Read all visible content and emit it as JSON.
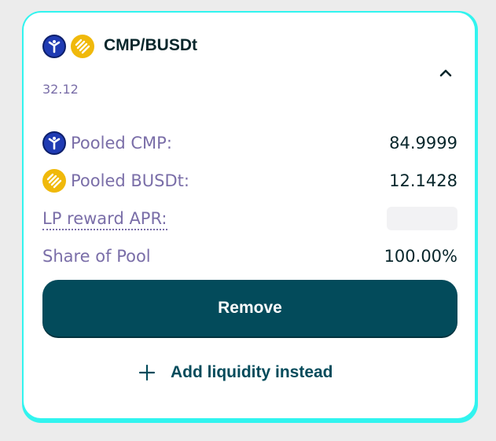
{
  "pair": {
    "title": "CMP/BUSDt",
    "balance": "32.12",
    "token0_icon": "cmp-token-icon",
    "token1_icon": "busdt-token-icon",
    "toggle_icon": "chevron-up-icon"
  },
  "details": {
    "pooled_token0_label": "Pooled CMP:",
    "pooled_token0_value": "84.9999",
    "pooled_token1_label": "Pooled BUSDt:",
    "pooled_token1_value": "12.1428",
    "apr_label": "LP reward APR:",
    "share_label": "Share of Pool",
    "share_value": "100.00%"
  },
  "actions": {
    "remove_label": "Remove",
    "add_label": "Add liquidity instead",
    "add_icon": "plus-icon"
  },
  "colors": {
    "accent_border": "#31f4ef",
    "primary_button": "#034b5b",
    "label_text": "#7a6ea8",
    "value_text": "#08262b",
    "cmp_blue": "#1f3bb3",
    "busd_yellow": "#f0b90b"
  }
}
